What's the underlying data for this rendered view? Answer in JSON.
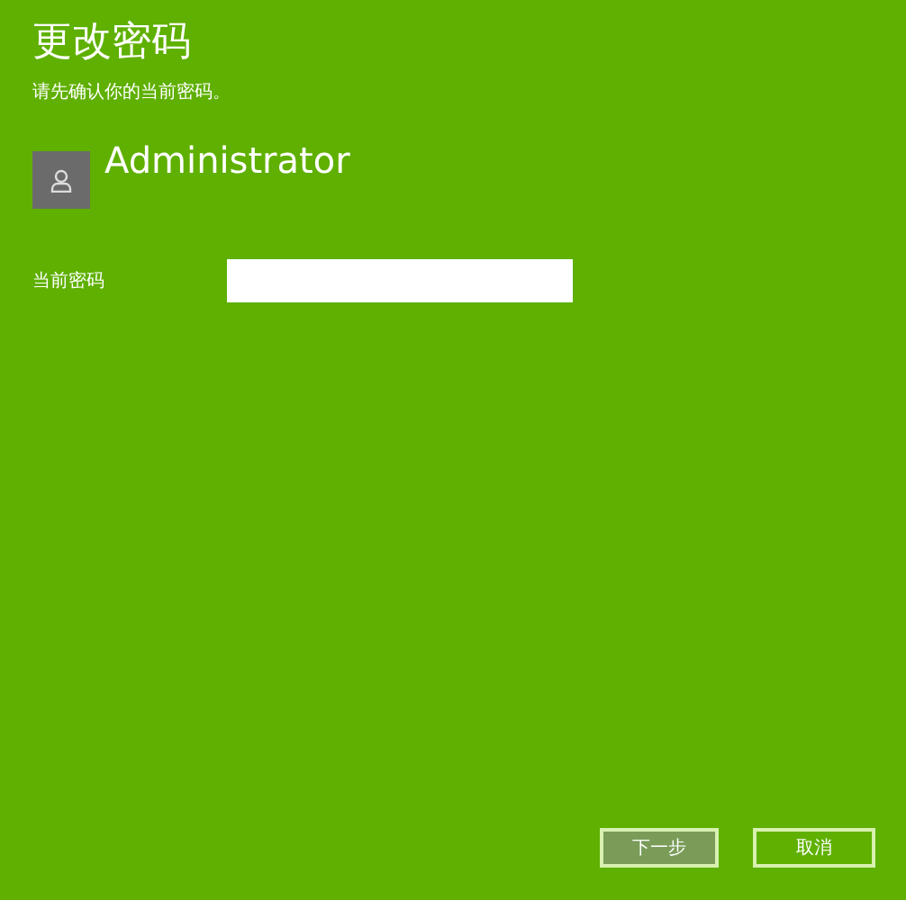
{
  "title": "更改密码",
  "subtitle": "请先确认你的当前密码。",
  "account": {
    "name": "Administrator"
  },
  "password_field": {
    "label": "当前密码"
  },
  "buttons": [
    {
      "label": "下一步",
      "kind": "primary"
    },
    {
      "label": "取消",
      "kind": "secondary"
    }
  ]
}
